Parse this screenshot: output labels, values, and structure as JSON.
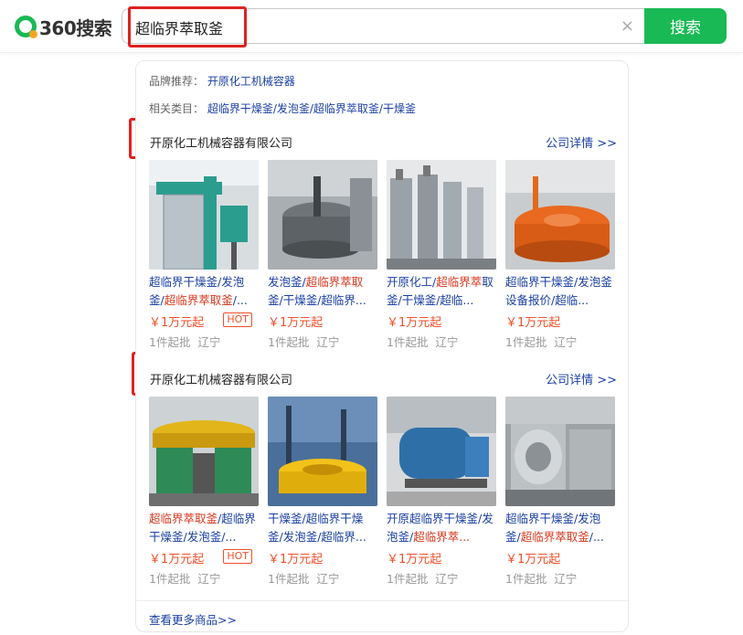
{
  "header": {
    "logo_text": "360搜索",
    "query": "超临界萃取釜",
    "clear_icon": "×",
    "search_label": "搜索",
    "accent_color": "#19b955"
  },
  "card": {
    "brand_label": "品牌推荐：",
    "brand_value": "开原化工机械容器",
    "category_label": "相关类目：",
    "category_value": "超临界干燥釜/发泡釜/超临界萃取釜/干燥釜",
    "companies": [
      {
        "name": "开原化工机械容器有限公司",
        "more": "公司详情 >>",
        "products": [
          {
            "t1": "超临界干燥釜/发泡",
            "t2": "釜/",
            "t2r": "超临界萃取釜",
            "t3": "/...",
            "price": "￥1万元起",
            "hot": "HOT",
            "moq": "1件起批",
            "region": "辽宁"
          },
          {
            "t1": "发泡釜/",
            "t1r": "超临界萃取",
            "t2": "釜/干燥釜/超临界...",
            "price": "￥1万元起",
            "moq": "1件起批",
            "region": "辽宁"
          },
          {
            "t1": "开原化工/",
            "t1r": "超临界萃",
            "t2": "取釜/干燥釜/超临...",
            "price": "￥1万元起",
            "moq": "1件起批",
            "region": "辽宁"
          },
          {
            "t1": "超临界干燥釜/发泡",
            "t2": "釜设备报价/超临...",
            "price": "￥1万元起",
            "moq": "1件起批",
            "region": "辽宁"
          }
        ]
      },
      {
        "name": "开原化工机械容器有限公司",
        "more": "公司详情 >>",
        "products": [
          {
            "t1r": "超临界萃取釜",
            "t1": "/超临",
            "t2": "界干燥釜/发泡釜/...",
            "price": "￥1万元起",
            "hot": "HOT",
            "moq": "1件起批",
            "region": "辽宁"
          },
          {
            "t1": "干燥釜/超临界干燥",
            "t2": "釜/发泡釜/超临界...",
            "price": "￥1万元起",
            "moq": "1件起批",
            "region": "辽宁"
          },
          {
            "t1": "开原超临界干燥釜/",
            "t2": "发泡釜/",
            "t2r": "超临界萃...",
            "price": "￥1万元起",
            "moq": "1件起批",
            "region": "辽宁"
          },
          {
            "t1": "超临界干燥釜/发泡",
            "t2": "釜/",
            "t2r": "超临界萃取釜",
            "t3": "/...",
            "price": "￥1万元起",
            "moq": "1件起批",
            "region": "辽宁"
          }
        ]
      }
    ],
    "more_goods": "查看更多商品>>"
  }
}
